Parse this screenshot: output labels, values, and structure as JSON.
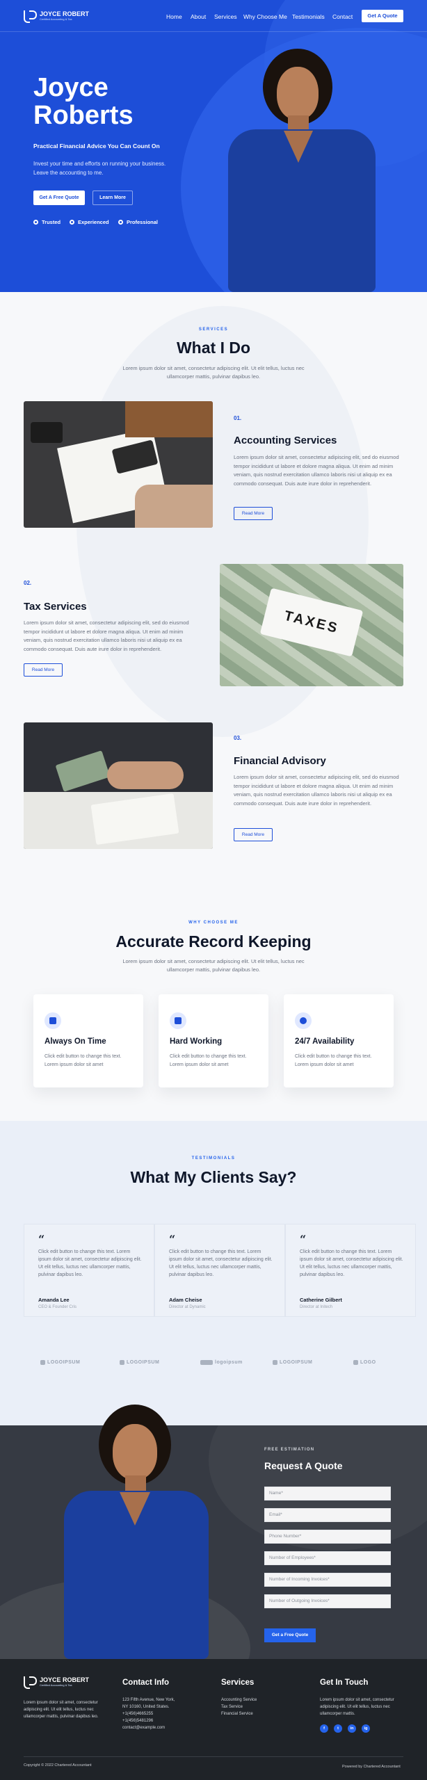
{
  "brand": {
    "name": "JOYCE ROBERT",
    "tagline": "Certified Accounting & Tax"
  },
  "nav": {
    "items": [
      "Home",
      "About",
      "Services",
      "Why Choose Me",
      "Testimonials",
      "Contact"
    ],
    "cta": "Get A Quote"
  },
  "hero": {
    "title_line1": "Joyce",
    "title_line2": "Roberts",
    "subtitle": "Practical Financial Advice You Can Count On",
    "desc": "Invest your time and efforts on running your business. Leave the accounting to me.",
    "primary_btn": "Get A Free Quote",
    "secondary_btn": "Learn More",
    "badges": [
      "Trusted",
      "Experienced",
      "Professional"
    ]
  },
  "services": {
    "eyebrow": "SERVICES",
    "heading": "What I Do",
    "lead": "Lorem ipsum dolor sit amet, consectetur adipiscing elit. Ut elit tellus, luctus nec ullamcorper mattis, pulvinar dapibus leo.",
    "items": [
      {
        "num": "01.",
        "title": "Accounting Services",
        "text": "Lorem ipsum dolor sit amet, consectetur adipiscing elit, sed do eiusmod tempor incididunt ut labore et dolore magna aliqua. Ut enim ad minim veniam, quis nostrud exercitation ullamco laboris nisi ut aliquip ex ea commodo consequat. Duis aute irure dolor in reprehenderit.",
        "btn": "Read More"
      },
      {
        "num": "02.",
        "title": "Tax Services",
        "text": "Lorem ipsum dolor sit amet, consectetur adipiscing elit, sed do eiusmod tempor incididunt ut labore et dolore magna aliqua. Ut enim ad minim veniam, quis nostrud exercitation ullamco laboris nisi ut aliquip ex ea commodo consequat. Duis aute irure dolor in reprehenderit.",
        "btn": "Read More",
        "img_label": "TAXES"
      },
      {
        "num": "03.",
        "title": "Financial Advisory",
        "text": "Lorem ipsum dolor sit amet, consectetur adipiscing elit, sed do eiusmod tempor incididunt ut labore et dolore magna aliqua. Ut enim ad minim veniam, quis nostrud exercitation ullamco laboris nisi ut aliquip ex ea commodo consequat. Duis aute irure dolor in reprehenderit.",
        "btn": "Read More"
      }
    ]
  },
  "why": {
    "eyebrow": "WHY CHOOSE ME",
    "heading": "Accurate Record Keeping",
    "lead": "Lorem ipsum dolor sit amet, consectetur adipiscing elit. Ut elit tellus, luctus nec ullamcorper mattis, pulvinar dapibus leo.",
    "cards": [
      {
        "title": "Always On Time",
        "text": "Click edit button to change this text. Lorem ipsum dolor sit amet",
        "icon": "calendar-check-icon"
      },
      {
        "title": "Hard Working",
        "text": "Click edit button to change this text. Lorem ipsum dolor sit amet",
        "icon": "briefcase-icon"
      },
      {
        "title": "24/7 Availability",
        "text": "Click edit button to change this text. Lorem ipsum dolor sit amet",
        "icon": "clock-icon"
      }
    ]
  },
  "testimonials": {
    "eyebrow": "TESTIMONIALS",
    "heading": "What My Clients Say?",
    "items": [
      {
        "quote": "Click edit button to change this text. Lorem ipsum dolor sit amet, consectetur adipiscing elit. Ut elit tellus, luctus nec ullamcorper mattis, pulvinar dapibus leo.",
        "name": "Amanda Lee",
        "role": "CEO & Founder Cris"
      },
      {
        "quote": "Click edit button to change this text. Lorem ipsum dolor sit amet, consectetur adipiscing elit. Ut elit tellus, luctus nec ullamcorper mattis, pulvinar dapibus leo.",
        "name": "Adam Cheise",
        "role": "Director at Dynamic"
      },
      {
        "quote": "Click edit button to change this text. Lorem ipsum dolor sit amet, consectetur adipiscing elit. Ut elit tellus, luctus nec ullamcorper mattis, pulvinar dapibus leo.",
        "name": "Catherine Gilbert",
        "role": "Director at Initech"
      }
    ],
    "partner_logos": [
      "LOGOIPSUM",
      "LOGOIPSUM",
      "logoipsum",
      "LOGOIPSUM",
      "LOGO"
    ]
  },
  "request": {
    "eyebrow": "FREE ESTIMATION",
    "heading": "Request A Quote",
    "fields": [
      "Name*",
      "Email*",
      "Phone Number*",
      "Number of Employees*",
      "Number of Incoming Invoices*",
      "Number of Outgoing Invoices*"
    ],
    "btn": "Get a Free Quote"
  },
  "footer": {
    "about": "Lorem ipsum dolor sit amet, consectetur adipiscing elit. Ut elit tellus, luctus nec ullamcorper mattis, pulvinar dapibus leo.",
    "contact_heading": "Contact Info",
    "contact_lines": [
      "123 Fifth Avenue, New York,",
      "NY 10160, United States.",
      "+1(456)4665255",
      "+1(456)5481296",
      "contact@example.com"
    ],
    "services_heading": "Services",
    "services": [
      "Accounting Service",
      "Tax Service",
      "Financial Service"
    ],
    "touch_heading": "Get In Touch",
    "touch_text": "Lorem ipsum dolor sit amet, consectetur adipiscing elit. Ut elit tellus, luctus nec ullamcorper mattis.",
    "social": [
      "f",
      "t",
      "in",
      "ig"
    ],
    "copyright": "Copyright © 2022 Chartered Accountant",
    "powered": "Powered by Chartered Accountant"
  },
  "colors": {
    "primary": "#1d4ed8",
    "dark": "#363a43",
    "footer": "#1f2328"
  }
}
